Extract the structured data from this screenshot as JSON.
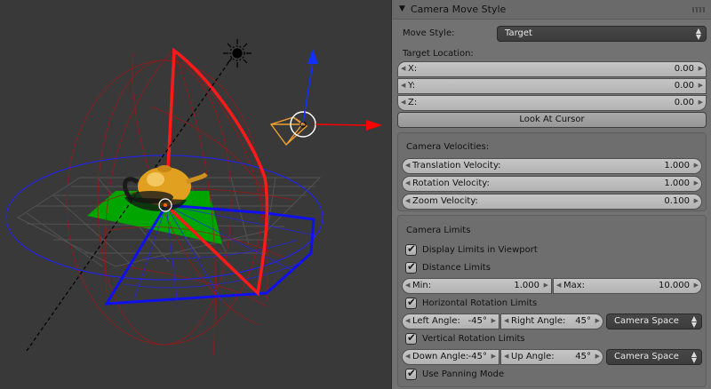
{
  "panel": {
    "title": "Camera Move Style",
    "move_style_label": "Move Style:",
    "move_style_value": "Target",
    "target_location_label": "Target Location:",
    "target": [
      {
        "key": "X:",
        "value": "0.00"
      },
      {
        "key": "Y:",
        "value": "0.00"
      },
      {
        "key": "Z:",
        "value": "0.00"
      }
    ],
    "look_at_cursor": "Look At Cursor",
    "velocities": {
      "label": "Camera Velocities:",
      "translation": {
        "key": "Translation Velocity:",
        "value": "1.000"
      },
      "rotation": {
        "key": "Rotation Velocity:",
        "value": "1.000"
      },
      "zoom": {
        "key": "Zoom Velocity:",
        "value": "0.100"
      }
    },
    "limits": {
      "label": "Camera Limits",
      "display_limits": {
        "label": "Display Limits in Viewport",
        "checked": true
      },
      "distance_limits": {
        "label": "Distance Limits",
        "checked": true
      },
      "min": {
        "key": "Min:",
        "value": "1.000"
      },
      "max": {
        "key": "Max:",
        "value": "10.000"
      },
      "horizontal": {
        "label": "Horizontal Rotation Limits",
        "checked": true
      },
      "left_angle": {
        "key": "Left Angle:",
        "value": "-45°"
      },
      "right_angle": {
        "key": "Right Angle:",
        "value": "45°"
      },
      "horizontal_space": "Camera Space",
      "vertical": {
        "label": "Vertical Rotation Limits",
        "checked": true
      },
      "down_angle": {
        "key": "Down Angle:",
        "value": "-45°"
      },
      "up_angle": {
        "key": "Up Angle:",
        "value": "45°"
      },
      "vertical_space": "Camera Space",
      "panning": {
        "label": "Use Panning Mode",
        "checked": true
      }
    }
  },
  "viewport": {
    "colors": {
      "background": "#393939",
      "limit_red": "#ff1a1a",
      "limit_blue": "#1a1aff",
      "axis_red": "#ff0000",
      "axis_blue": "#0033ff",
      "teapot": "#e8a020",
      "floor": "#00a000",
      "camera": "#f0a030"
    }
  },
  "icons": {
    "collapse": "triangle-down-icon",
    "grip": "panel-grip-icon",
    "check": "check-icon"
  }
}
